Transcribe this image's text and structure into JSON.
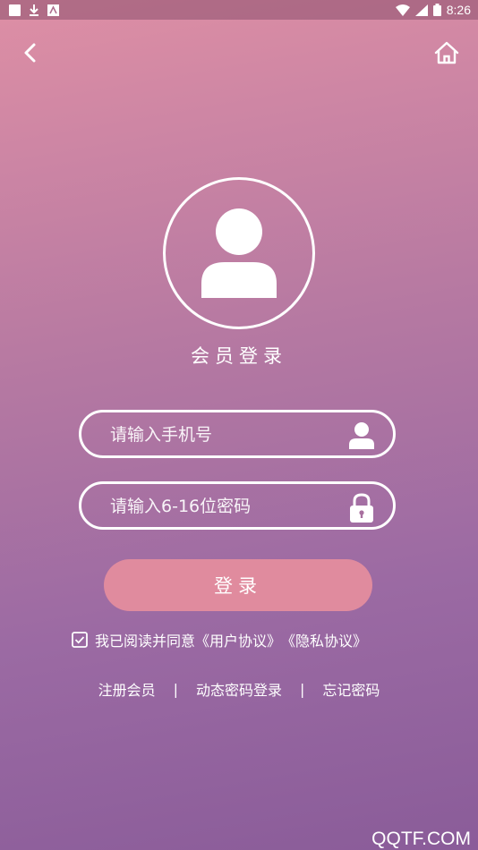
{
  "statusbar": {
    "time": "8:26"
  },
  "nav": {
    "back_icon": "chevron-left-icon",
    "home_icon": "home-icon"
  },
  "avatar": {
    "icon": "user-avatar-icon"
  },
  "page": {
    "title": "会员登录"
  },
  "form": {
    "phone_placeholder": "请输入手机号",
    "password_placeholder": "请输入6-16位密码",
    "login_label": "登录"
  },
  "agreement": {
    "text": "我已阅读并同意",
    "user_protocol": "《用户协议》",
    "privacy_protocol": "《隐私协议》",
    "checked": true
  },
  "links": {
    "register": "注册会员",
    "separator": "|",
    "sms_login": "动态密码登录",
    "forgot": "忘记密码"
  },
  "watermark": "QQTF.COM",
  "colors": {
    "button": "#e08b9e",
    "bg_top": "#de8fa5",
    "bg_bottom": "#8a5c99"
  }
}
